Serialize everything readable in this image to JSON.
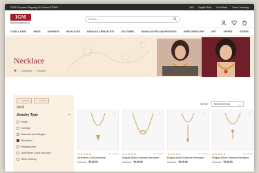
{
  "topbar": {
    "promo": "FREE Express Shipping On Orders ₹1000+",
    "links": [
      "Sell",
      "Digital Gold",
      "Gold Rate",
      "Order Tracking"
    ]
  },
  "header": {
    "logo_text": "IGM",
    "logo_sub": "India Gold Metaverse",
    "search_placeholder": "Search...",
    "icons": [
      "user-icon",
      "wishlist-icon",
      "cart-icon"
    ],
    "cart_count": "0"
  },
  "nav": {
    "items": [
      "COINS & BARS",
      "RINGS",
      "EARRINGS",
      "NECKLACES",
      "BANGLES & BRACELETS",
      "SOLITAIRES",
      "MANGALSUTRA AND PENDANTS",
      "MORE JEWELLERY",
      "GIFT",
      "OFFERS",
      "STORES"
    ]
  },
  "hero": {
    "title": "Necklace",
    "breadcrumb": [
      "Categories",
      "Necklace"
    ]
  },
  "filters": {
    "chips": [
      "Necklace",
      "Trending"
    ],
    "clear_all": "Clear All",
    "title": "Jewelry Type",
    "options": [
      {
        "label": "Rings",
        "checked": false
      },
      {
        "label": "Earrings",
        "checked": false
      },
      {
        "label": "Bracelets and Bangles",
        "checked": false
      },
      {
        "label": "Necklaces",
        "checked": true
      },
      {
        "label": "Mangalsutras",
        "checked": false
      },
      {
        "label": "Gold/Silver Coins and Bars",
        "checked": false
      },
      {
        "label": "Other Jewelry",
        "checked": false
      }
    ]
  },
  "sort": {
    "label": "Sort by:",
    "value": "Newest Arrivals"
  },
  "products": [
    {
      "name": "Geometric Gold Necklace",
      "old_price": "₹150.00",
      "price": "₹135.00",
      "reviews": "No reviews",
      "rating": 5
    },
    {
      "name": "Elegant Allure Diamond Necklace",
      "old_price": "₹150.00",
      "price": "₹135.00",
      "reviews": "No reviews",
      "rating": 5
    },
    {
      "name": "Elegant Allure Diamond Necklace",
      "old_price": "₹150.00",
      "price": "₹135.00",
      "reviews": "No reviews",
      "rating": 5
    },
    {
      "name": "Elegant Allure Diamond Necklace",
      "old_price": "₹150.00",
      "price": "₹135.00",
      "reviews": "No reviews",
      "rating": 5
    }
  ],
  "colors": {
    "brand": "#a01d2a",
    "accent": "#d98c2b",
    "hero_bg": "#f8ead9",
    "sidebar_bg": "#faf1e2"
  }
}
